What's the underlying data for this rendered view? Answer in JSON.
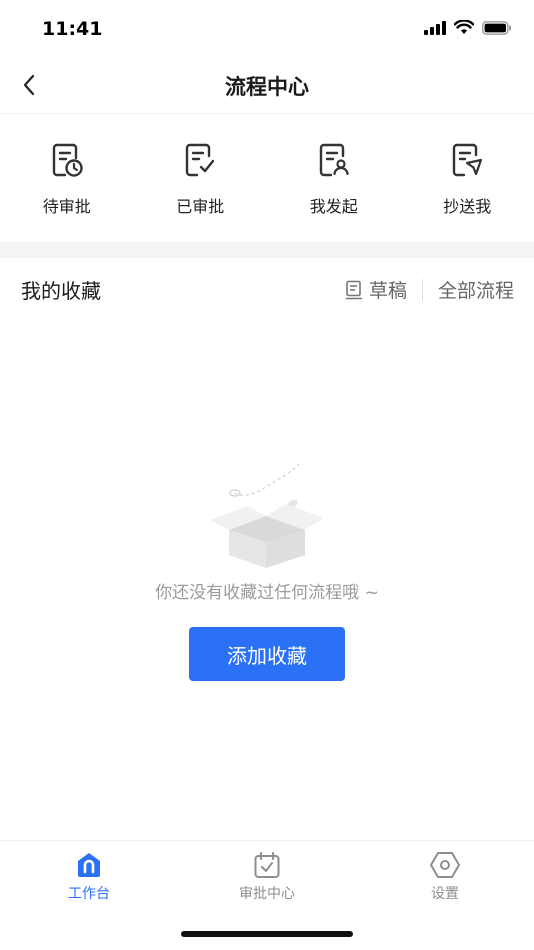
{
  "status": {
    "time": "11:41"
  },
  "nav": {
    "title": "流程中心",
    "back_icon": "chevron-left-icon"
  },
  "quick_actions": [
    {
      "label": "待审批",
      "icon": "doc-clock-icon"
    },
    {
      "label": "已审批",
      "icon": "doc-check-icon"
    },
    {
      "label": "我发起",
      "icon": "doc-person-icon"
    },
    {
      "label": "抄送我",
      "icon": "doc-send-icon"
    }
  ],
  "favorites": {
    "title": "我的收藏",
    "draft_label": "草稿",
    "all_label": "全部流程",
    "empty_text": "你还没有收藏过任何流程哦 ~",
    "add_button": "添加收藏"
  },
  "tabs": [
    {
      "label": "工作台",
      "icon": "home-icon",
      "active": true
    },
    {
      "label": "审批中心",
      "icon": "calendar-check-icon",
      "active": false
    },
    {
      "label": "设置",
      "icon": "settings-hexagon-icon",
      "active": false
    }
  ],
  "colors": {
    "accent": "#2b71f5",
    "muted": "#9b9b9b"
  }
}
